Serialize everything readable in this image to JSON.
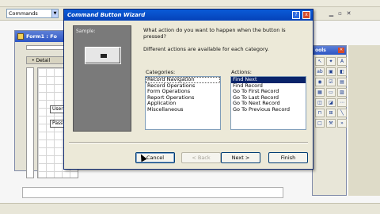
{
  "toolbar": {
    "object_combo": "Commands"
  },
  "bg_window": {
    "title": "Form1 : Fo",
    "detail_label": "• Detail",
    "label_username": "Username",
    "label_password": "Password"
  },
  "toolbox": {
    "title": "ools"
  },
  "wizard": {
    "title": "Command Button Wizard",
    "help_icon": "?",
    "close_icon": "x",
    "sample_label": "Sample:",
    "question": "What action do you want to happen when the button is pressed?",
    "info": "Different actions are available for each category.",
    "categories_label": "Categories:",
    "actions_label": "Actions:",
    "categories": [
      "Record Navigation",
      "Record Operations",
      "Form Operations",
      "Report Operations",
      "Application",
      "Miscellaneous"
    ],
    "actions": [
      "Find Next",
      "Find Record",
      "Go To First Record",
      "Go To Last Record",
      "Go To Next Record",
      "Go To Previous Record"
    ],
    "buttons": {
      "cancel": "Cancel",
      "back": "< Back",
      "next": "Next >",
      "finish": "Finish"
    }
  }
}
